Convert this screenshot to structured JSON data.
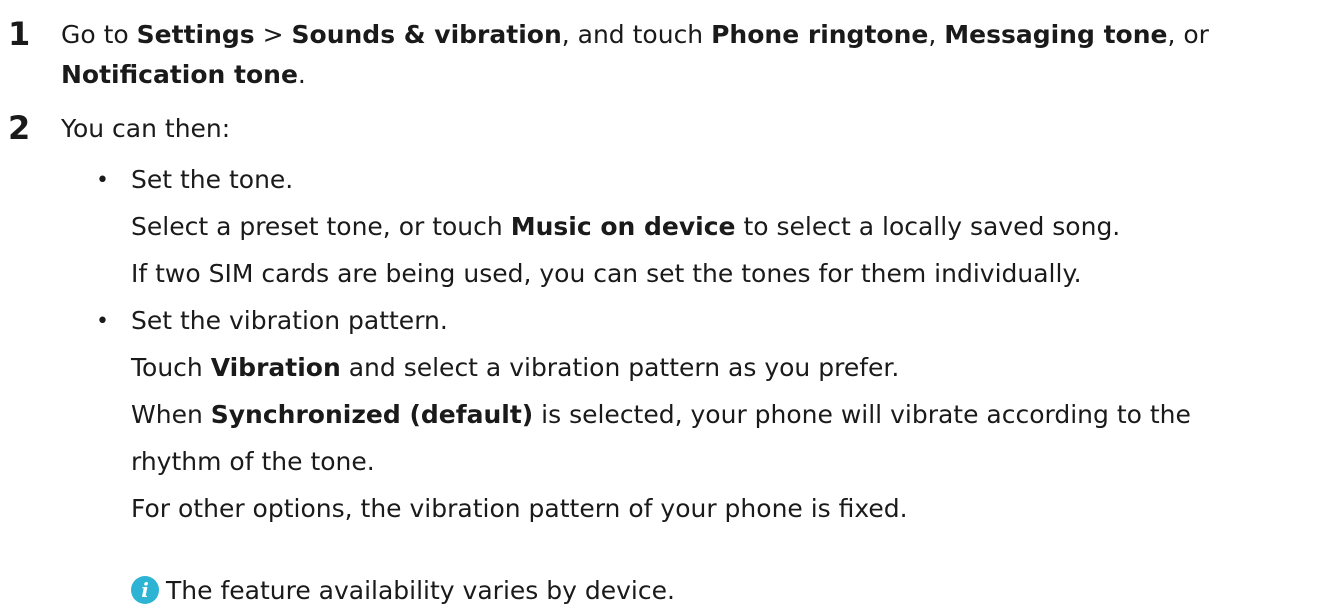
{
  "steps": [
    {
      "number": "1",
      "line1": {
        "t1": "Go to ",
        "b1": "Settings",
        "t2": " > ",
        "b2": "Sounds & vibration",
        "t3": ", and touch ",
        "b3": "Phone ringtone",
        "t4": ", ",
        "b4": "Messaging tone",
        "t5": ", or"
      },
      "line2": {
        "b1": "Notification tone",
        "t1": "."
      }
    },
    {
      "number": "2",
      "intro": "You can then:"
    }
  ],
  "bullets": [
    {
      "symbol": "•",
      "heading": "Set the tone.",
      "lines": {
        "l1": {
          "t1": "Select a preset tone, or touch ",
          "b1": "Music on device",
          "t2": " to select a locally saved song."
        },
        "l2": {
          "t1": "If two SIM cards are being used, you can set the tones for them individually."
        }
      }
    },
    {
      "symbol": "•",
      "heading": "Set the vibration pattern.",
      "lines": {
        "l1": {
          "t1": "Touch ",
          "b1": "Vibration",
          "t2": " and select a vibration pattern as you prefer."
        },
        "l2": {
          "t1": "When ",
          "b1": "Synchronized (default)",
          "t2": " is selected, your phone will vibrate according to the"
        },
        "l3": {
          "t1": "rhythm of the tone."
        },
        "l4": {
          "t1": "For other options, the vibration pattern of your phone is fixed."
        }
      }
    }
  ],
  "note": {
    "icon": "info-icon",
    "icon_glyph": "i",
    "icon_color": "#2db3d3",
    "text": "The feature availability varies by device."
  }
}
